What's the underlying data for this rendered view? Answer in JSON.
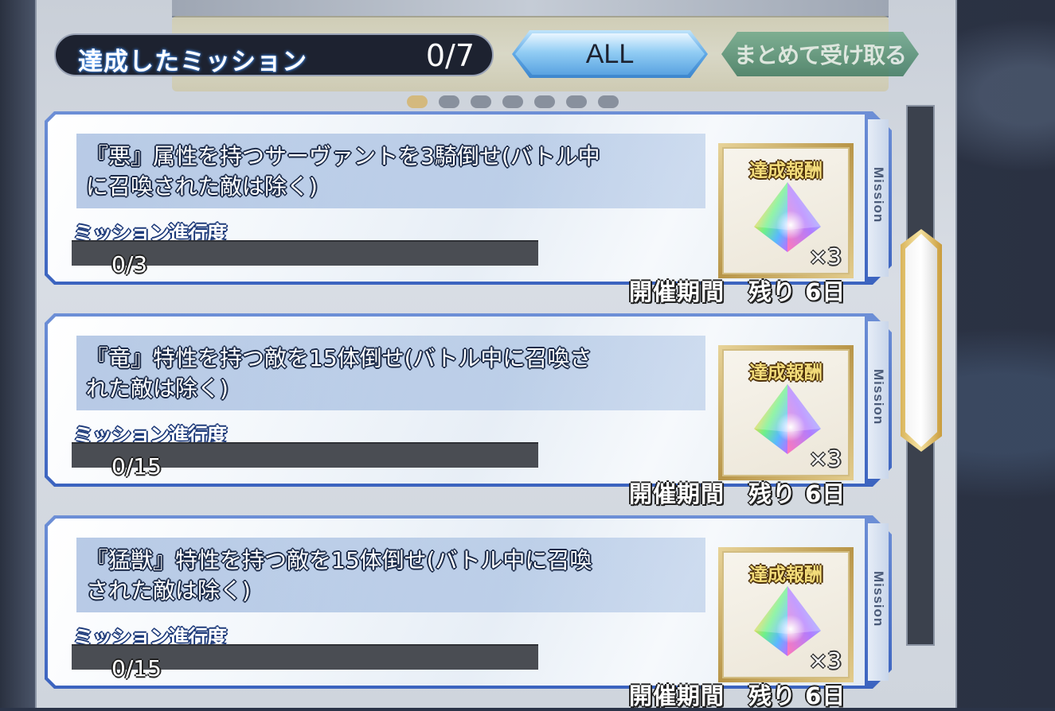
{
  "header": {
    "achieved_label": "達成したミッション",
    "achieved_count": "0/7",
    "filter_label": "ALL",
    "receive_all_label": "まとめて受け取る"
  },
  "colors": {
    "card_frame": "#3b63bf",
    "filter_button": "#5fa8e6",
    "receive_button": "#3f7a60",
    "progress_empty": "#4a4d53",
    "scroll_thumb_rim": "#d9b45a"
  },
  "missions": [
    {
      "description_line1": "『悪』属性を持つサーヴァントを3騎倒せ(バトル中",
      "description_line2": "に召喚された敵は除く)",
      "progress_label": "ミッション進行度",
      "progress_text": "0/3",
      "progress_fraction": 0,
      "reward_title": "達成報酬",
      "reward_icon": "rainbow-quartz-icon",
      "reward_qty": "×3",
      "side_label": "Mission",
      "period_label": "開催期間　残り 6日"
    },
    {
      "description_line1": "『竜』特性を持つ敵を15体倒せ(バトル中に召喚さ",
      "description_line2": "れた敵は除く)",
      "progress_label": "ミッション進行度",
      "progress_text": "0/15",
      "progress_fraction": 0,
      "reward_title": "達成報酬",
      "reward_icon": "rainbow-quartz-icon",
      "reward_qty": "×3",
      "side_label": "Mission",
      "period_label": "開催期間　残り 6日"
    },
    {
      "description_line1": "『猛獣』特性を持つ敵を15体倒せ(バトル中に召喚",
      "description_line2": "された敵は除く)",
      "progress_label": "ミッション進行度",
      "progress_text": "0/15",
      "progress_fraction": 0,
      "reward_title": "達成報酬",
      "reward_icon": "rainbow-quartz-icon",
      "reward_qty": "×3",
      "side_label": "Mission",
      "period_label": "開催期間　残り 6日"
    }
  ]
}
